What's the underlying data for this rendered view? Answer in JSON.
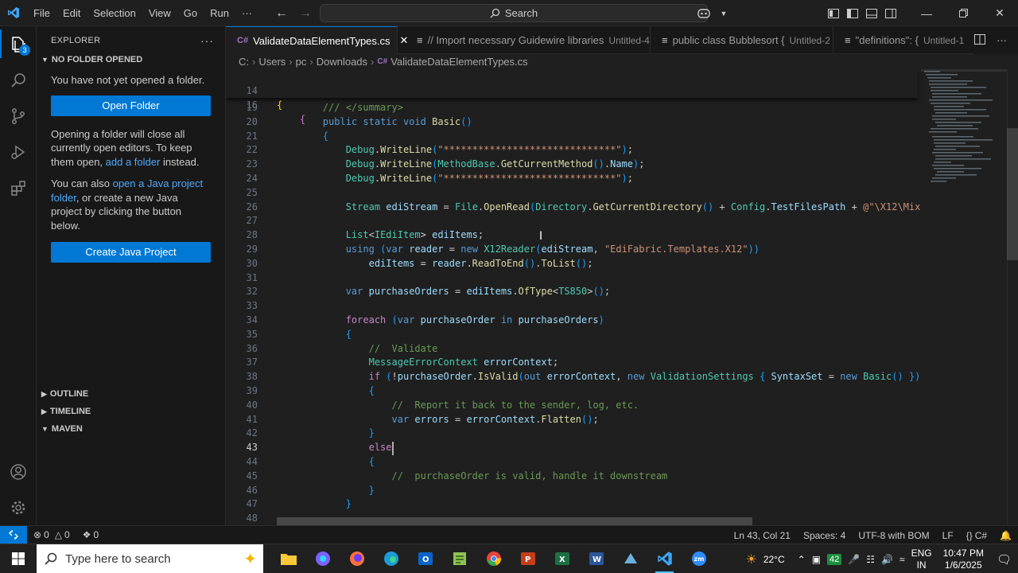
{
  "titlebar": {
    "menu": [
      "File",
      "Edit",
      "Selection",
      "View",
      "Go",
      "Run",
      "···"
    ],
    "search_label": "Search"
  },
  "activitybar": {
    "explorer_badge": "3"
  },
  "sidebar": {
    "title": "EXPLORER",
    "no_folder": "NO FOLDER OPENED",
    "msg1": "You have not yet opened a folder.",
    "open_folder": "Open Folder",
    "msg2_a": "Opening a folder will close all currently open editors. To keep them open, ",
    "msg2_link": "add a folder",
    "msg2_b": " instead.",
    "msg3_a": "You can also ",
    "msg3_link": "open a Java project folder",
    "msg3_b": ", or create a new Java project by clicking the button below.",
    "create_java": "Create Java Project",
    "outline": "OUTLINE",
    "timeline": "TIMELINE",
    "maven": "MAVEN"
  },
  "tabs": [
    {
      "label": "ValidateDataElementTypes.cs",
      "sub": "",
      "active": true
    },
    {
      "label": "// Import necessary Guidewire libraries",
      "sub": "Untitled-4"
    },
    {
      "label": "public class Bubblesort {",
      "sub": "Untitled-2"
    },
    {
      "label": "\"definitions\": {",
      "sub": "Untitled-1"
    }
  ],
  "breadcrumb": [
    "C:",
    "Users",
    "pc",
    "Downloads",
    "ValidateDataElementTypes.cs"
  ],
  "editor": {
    "sticky": [
      {
        "n": "14",
        "text": "{"
      },
      {
        "n": "16",
        "text": "    {"
      }
    ],
    "lines": [
      {
        "n": "19",
        "t": "        /// </summary>"
      },
      {
        "n": "20",
        "t": "        public static void Basic()"
      },
      {
        "n": "21",
        "t": "        {"
      },
      {
        "n": "22",
        "t": "            Debug.WriteLine(\"******************************\");"
      },
      {
        "n": "23",
        "t": "            Debug.WriteLine(MethodBase.GetCurrentMethod().Name);"
      },
      {
        "n": "24",
        "t": "            Debug.WriteLine(\"******************************\");"
      },
      {
        "n": "25",
        "t": ""
      },
      {
        "n": "26",
        "t": "            Stream ediStream = File.OpenRead(Directory.GetCurrentDirectory() + Config.TestFilesPath + @\"\\X12\\Mix"
      },
      {
        "n": "27",
        "t": ""
      },
      {
        "n": "28",
        "t": "            List<IEdiItem> ediItems;"
      },
      {
        "n": "29",
        "t": "            using (var reader = new X12Reader(ediStream, \"EdiFabric.Templates.X12\"))"
      },
      {
        "n": "30",
        "t": "                ediItems = reader.ReadToEnd().ToList();"
      },
      {
        "n": "31",
        "t": ""
      },
      {
        "n": "32",
        "t": "            var purchaseOrders = ediItems.OfType<TS850>();"
      },
      {
        "n": "33",
        "t": ""
      },
      {
        "n": "34",
        "t": "            foreach (var purchaseOrder in purchaseOrders)"
      },
      {
        "n": "35",
        "t": "            {"
      },
      {
        "n": "36",
        "t": "                //  Validate"
      },
      {
        "n": "37",
        "t": "                MessageErrorContext errorContext;"
      },
      {
        "n": "38",
        "t": "                if (!purchaseOrder.IsValid(out errorContext, new ValidationSettings { SyntaxSet = new Basic() })"
      },
      {
        "n": "39",
        "t": "                {"
      },
      {
        "n": "40",
        "t": "                    //  Report it back to the sender, log, etc."
      },
      {
        "n": "41",
        "t": "                    var errors = errorContext.Flatten();"
      },
      {
        "n": "42",
        "t": "                }"
      },
      {
        "n": "43",
        "t": "                else"
      },
      {
        "n": "44",
        "t": "                {"
      },
      {
        "n": "45",
        "t": "                    //  purchaseOrder is valid, handle it downstream"
      },
      {
        "n": "46",
        "t": "                }"
      },
      {
        "n": "47",
        "t": "            }"
      },
      {
        "n": "48",
        "t": ""
      }
    ]
  },
  "status": {
    "errors": "0",
    "warnings": "0",
    "ports": "0",
    "position": "Ln 43, Col 21",
    "spaces": "Spaces: 4",
    "encoding": "UTF-8 with BOM",
    "eol": "LF",
    "language": "C#"
  },
  "taskbar": {
    "search_placeholder": "Type here to search",
    "weather": "22°C",
    "lang1": "ENG",
    "lang2": "IN",
    "time": "10:47 PM",
    "date": "1/6/2025",
    "badge": "42"
  }
}
